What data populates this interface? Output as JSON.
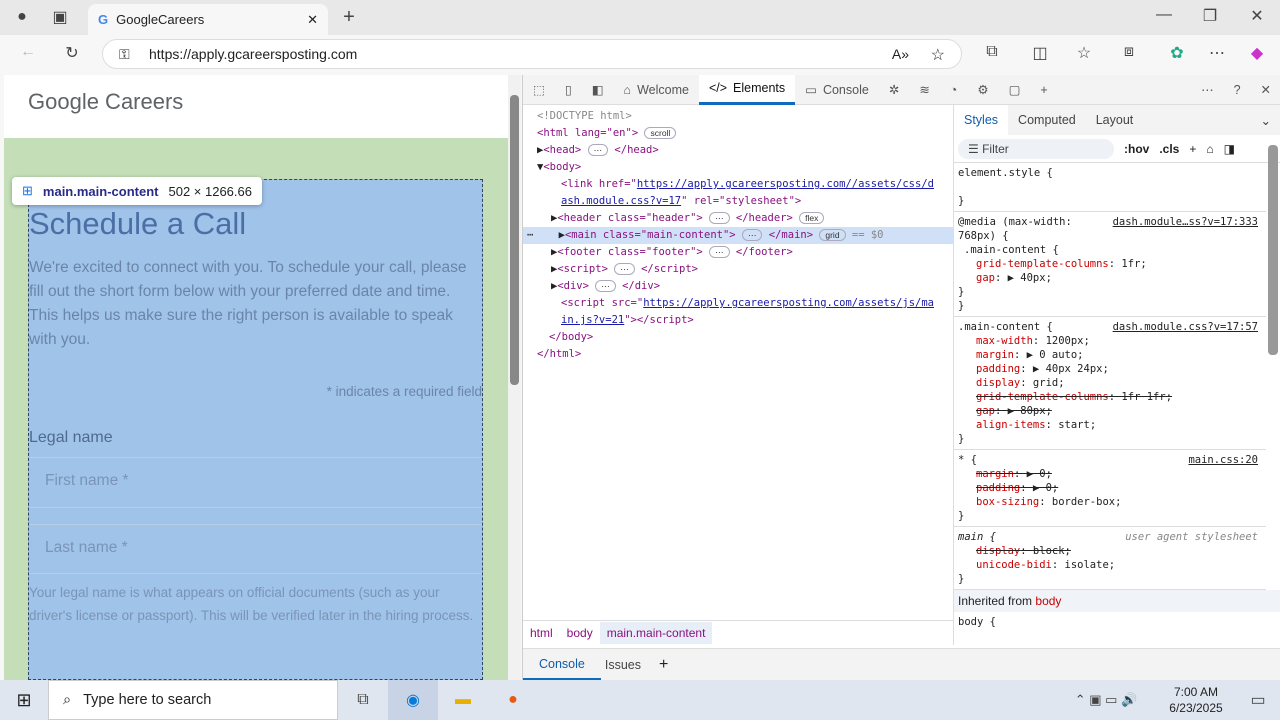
{
  "browser": {
    "tab_title": "GoogleCareers",
    "url": "https://apply.gcareersposting.com"
  },
  "page": {
    "logo": "Google Careers",
    "title": "Schedule a Call",
    "intro": "We're excited to connect with you. To schedule your call, please fill out the short form below with your preferred date and time. This helps us make sure the right person is available to speak with you.",
    "required_note": "* indicates a required field",
    "legal_label": "Legal name",
    "first_ph": "First name *",
    "last_ph": "Last name *",
    "help": "Your legal name is what appears on official documents (such as your driver's license or passport). This will be verified later in the hiring process."
  },
  "tooltip": {
    "selector": "main.main-content",
    "size": "502 × 1266.66"
  },
  "devtools": {
    "tabs": [
      "Welcome",
      "Elements",
      "Console"
    ],
    "dom": {
      "doctype": "<!DOCTYPE html>",
      "html_open": "<html lang=\"en\">",
      "scroll": "scroll",
      "head": "<head>",
      "head_close": "</head>",
      "body": "<body>",
      "link_pre": "<link href=\"",
      "link_url1": "https://apply.gcareersposting.com//assets/css/d",
      "link_url2": "ash.module.css?v=17",
      "link_post": "\" rel=\"stylesheet\">",
      "header": "<header class=\"header\">",
      "header_close": "</header>",
      "flex": "flex",
      "main": "<main class=\"main-content\">",
      "main_close": "</main>",
      "grid": "grid",
      "eq": "== $0",
      "footer": "<footer class=\"footer\">",
      "footer_close": "</footer>",
      "script": "<script>",
      "script_close": "</script>",
      "div": "<div>",
      "div_close": "</div>",
      "script_src_pre": "<script src=\"",
      "script_url1": "https://apply.gcareersposting.com/assets/js/ma",
      "script_url2": "in.js?v=21",
      "script_src_post": "\"></script>",
      "body_close": "</body>",
      "html_close": "</html>"
    },
    "breadcrumbs": [
      "html",
      "body",
      "main.main-content"
    ],
    "drawer": [
      "Console",
      "Issues"
    ],
    "styles": {
      "tabs": [
        "Styles",
        "Computed",
        "Layout"
      ],
      "filter": "Filter",
      "hov": ":hov",
      "cls": ".cls",
      "rules": [
        {
          "sel": "element.style {",
          "src": "",
          "props": []
        },
        {
          "sel": "@media (max-width: 768px) {",
          "sub": ".main-content {",
          "src": "dash.module…ss?v=17:333",
          "props": [
            [
              "grid-template-columns",
              "1fr",
              false
            ],
            [
              "gap",
              "▶ 40px",
              false
            ]
          ]
        },
        {
          "sel": ".main-content {",
          "src": "dash.module.css?v=17:57",
          "props": [
            [
              "max-width",
              "1200px",
              false
            ],
            [
              "margin",
              "▶ 0 auto",
              false
            ],
            [
              "padding",
              "▶ 40px 24px",
              false
            ],
            [
              "display",
              "grid",
              false
            ],
            [
              "grid-template-columns",
              "1fr 1fr",
              true
            ],
            [
              "gap",
              "▶ 80px",
              true
            ],
            [
              "align-items",
              "start",
              false
            ]
          ]
        },
        {
          "sel": "* {",
          "src": "main.css:20",
          "props": [
            [
              "margin",
              "▶ 0",
              true
            ],
            [
              "padding",
              "▶ 0",
              true
            ],
            [
              "box-sizing",
              "border-box",
              false
            ]
          ]
        },
        {
          "sel": "main {",
          "src": "user agent stylesheet",
          "props": [
            [
              "display",
              "block",
              true
            ],
            [
              "unicode-bidi",
              "isolate",
              false
            ]
          ]
        }
      ],
      "inherited": "Inherited from",
      "inherited_from": "body",
      "body_rule": "body {"
    }
  },
  "taskbar": {
    "search": "Type here to search",
    "time": "7:00 AM",
    "date": "6/23/2025"
  }
}
